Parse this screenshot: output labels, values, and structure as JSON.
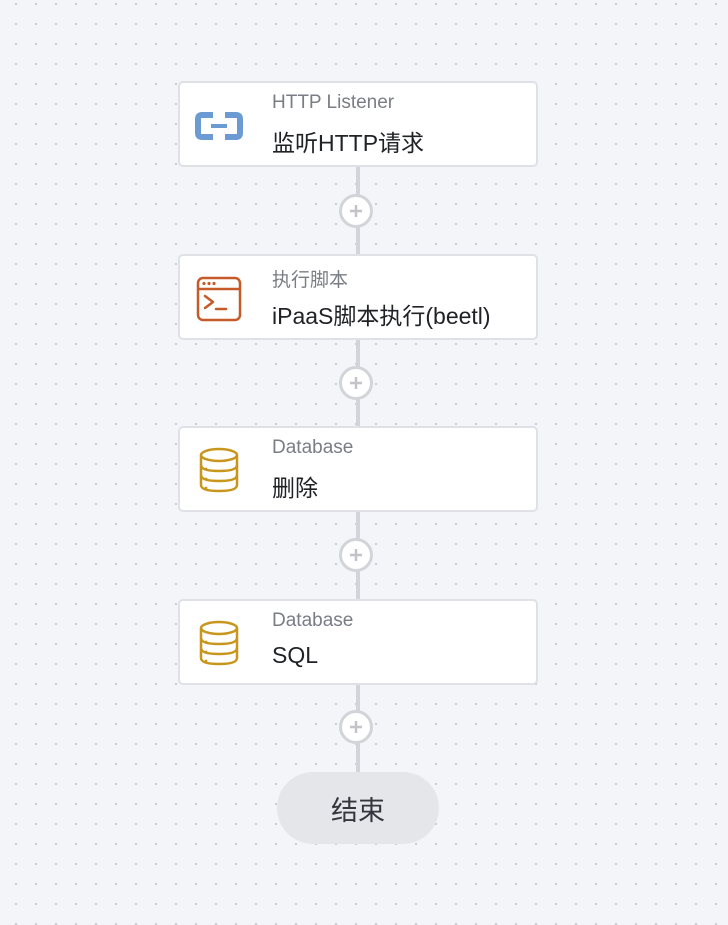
{
  "nodes": [
    {
      "type": "HTTP Listener",
      "name": "监听HTTP请求",
      "icon": "http-listener-icon",
      "color": "#6b9bd2"
    },
    {
      "type": "执行脚本",
      "name": "iPaaS脚本执行(beetl)",
      "icon": "terminal-icon",
      "color": "#c65a28"
    },
    {
      "type": "Database",
      "name": "删除",
      "icon": "database-icon",
      "color": "#c8961c"
    },
    {
      "type": "Database",
      "name": "SQL",
      "icon": "database-icon",
      "color": "#c8961c"
    }
  ],
  "end": {
    "label": "结束"
  },
  "add_button": {
    "icon": "plus-icon"
  },
  "colors": {
    "canvas": "#f4f5f9",
    "connector": "#d2d4d9",
    "node_border": "#dfe1e6",
    "end_fill": "#e4e6ea"
  }
}
